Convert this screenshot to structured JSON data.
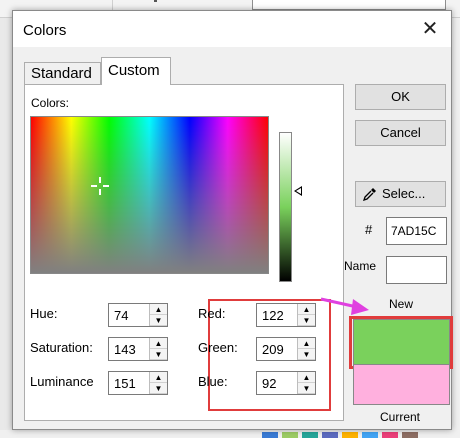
{
  "dialog": {
    "title": "Colors"
  },
  "tabs": [
    {
      "label": "Standard"
    },
    {
      "label": "Custom"
    }
  ],
  "custom": {
    "colors_label": "Colors:",
    "hsl": [
      {
        "label": "Hue:",
        "value": "74"
      },
      {
        "label": "Saturation:",
        "value": "143"
      },
      {
        "label": "Luminance",
        "value": "151"
      }
    ],
    "rgb": [
      {
        "label": "Red:",
        "value": "122"
      },
      {
        "label": "Green:",
        "value": "209"
      },
      {
        "label": "Blue:",
        "value": "92"
      }
    ]
  },
  "buttons": {
    "ok": "OK",
    "cancel": "Cancel",
    "select": "Selec..."
  },
  "hex": {
    "label": "#",
    "value": "7AD15C"
  },
  "name": {
    "label": "Name",
    "value": ""
  },
  "preview": {
    "new_label": "New",
    "current_label": "Current",
    "new_color": "#7AD15C",
    "current_color": "#FFB0DE"
  },
  "colors": {
    "annotation": "#E03C3C",
    "pointer": "#E040E0"
  }
}
